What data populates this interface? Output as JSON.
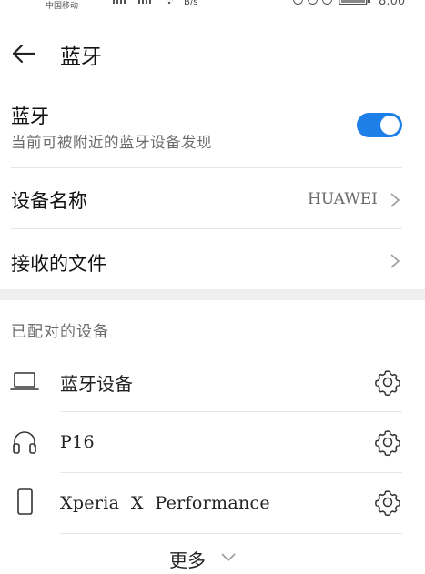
{
  "status_bar": {
    "carrier": "中国移动",
    "speed": "B/s",
    "time": "8:00"
  },
  "header": {
    "title": "蓝牙"
  },
  "bluetooth": {
    "title": "蓝牙",
    "subtitle": "当前可被附近的蓝牙设备发现",
    "enabled": true,
    "accent_color": "#1f7fe8"
  },
  "device_name": {
    "label": "设备名称",
    "value": "HUAWEI"
  },
  "received_files": {
    "label": "接收的文件"
  },
  "paired": {
    "section_title": "已配对的设备",
    "devices": [
      {
        "name": "蓝牙设备",
        "icon": "laptop-icon"
      },
      {
        "name": "P16",
        "icon": "headphones-icon"
      },
      {
        "name": "Xperia  X  Performance",
        "icon": "phone-icon"
      }
    ]
  },
  "more": {
    "label": "更多"
  }
}
